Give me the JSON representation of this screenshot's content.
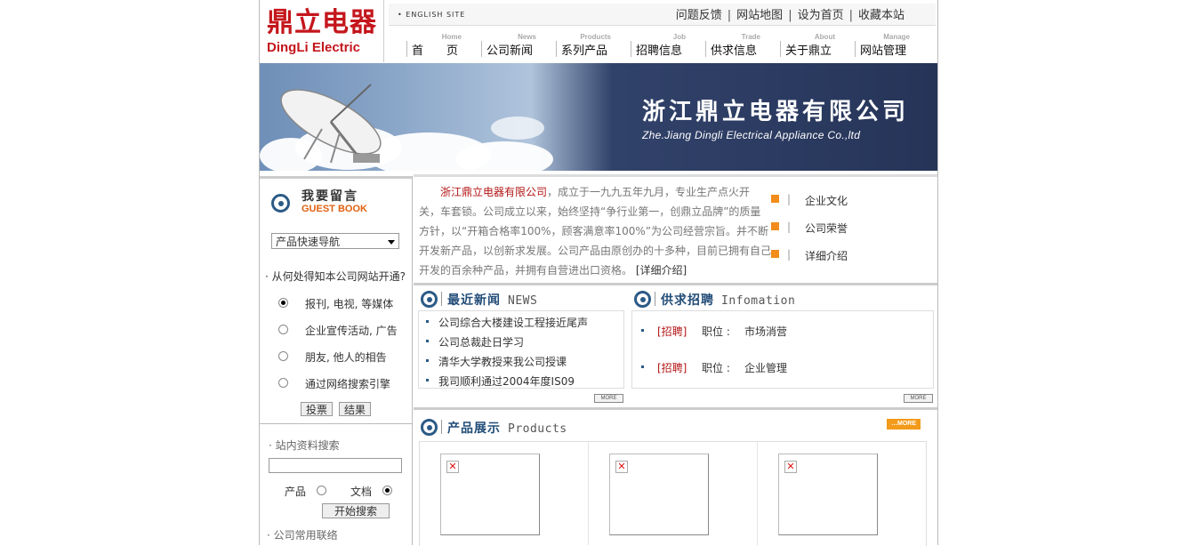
{
  "brand": {
    "cn": "鼎立电器",
    "en": "DingLi Electric"
  },
  "topbar": {
    "english": "ENGLISH SITE",
    "links": [
      "问题反馈",
      "网站地图",
      "设为首页",
      "收藏本站"
    ]
  },
  "nav": [
    {
      "en": "Home",
      "cn": "首　　页"
    },
    {
      "en": "News",
      "cn": "公司新闻"
    },
    {
      "en": "Products",
      "cn": "系列产品"
    },
    {
      "en": "Job",
      "cn": "招聘信息"
    },
    {
      "en": "Trade",
      "cn": "供求信息"
    },
    {
      "en": "About",
      "cn": "关于鼎立"
    },
    {
      "en": "Manage",
      "cn": "网站管理"
    }
  ],
  "banner": {
    "title": "浙江鼎立电器有限公司",
    "subtitle": "Zhe.Jiang Dingli Electrical Appliance Co.,ltd"
  },
  "guestbook": {
    "cn": "我要留言",
    "en": "GUEST BOOK"
  },
  "quicknav": {
    "selected": "产品快速导航"
  },
  "poll": {
    "question": "· 从何处得知本公司网站开通?",
    "options": [
      {
        "label": "报刊, 电视, 等媒体",
        "checked": true
      },
      {
        "label": "企业宣传活动, 广告",
        "checked": false
      },
      {
        "label": "朋友, 他人的相告",
        "checked": false
      },
      {
        "label": "通过网络搜索引擎",
        "checked": false
      }
    ],
    "vote_label": "投票",
    "result_label": "结果"
  },
  "search": {
    "title": "· 站内资料搜索",
    "value": "",
    "options": [
      {
        "label": "产品",
        "checked": false
      },
      {
        "label": "文档",
        "checked": true
      }
    ],
    "button_label": "开始搜索"
  },
  "contact": {
    "title": "· 公司常用联络"
  },
  "intro": {
    "company": "浙江鼎立电器有限公司",
    "body": "，成立于一九九五年九月，专业生产点火开关，车套锁。公司成立以来，始终坚持“争行业第一，创鼎立品牌”的质量方针，以“开箱合格率100%，顾客满意率100%”为公司经营宗旨。并不断开发新产品，以创新求发展。公司产品由原创办的十多种，目前已拥有自己开发的百余种产品，并拥有自营进出口资格。",
    "more": "[详细介绍]",
    "links": [
      "企业文化",
      "公司荣誉",
      "详细介绍"
    ]
  },
  "news": {
    "title": "最近新闻",
    "title_en": "NEWS",
    "items": [
      "公司综合大楼建设工程接近尾声",
      "公司总裁赴日学习",
      "清华大学教授来我公司授课",
      "我司顺利通过2004年度IS09"
    ],
    "more": "MORE"
  },
  "jobs": {
    "title": "供求招聘",
    "title_en": "Infomation",
    "items": [
      {
        "tag": "[招聘]",
        "role": "职位 :",
        "value": "市场消营"
      },
      {
        "tag": "[招聘]",
        "role": "职位 :",
        "value": "企业管理"
      }
    ],
    "more": "MORE"
  },
  "products": {
    "title": "产品展示",
    "title_en": "Products",
    "more": "MORE"
  },
  "colors": {
    "brand_red": "#c4161c",
    "accent_orange": "#f39a1a",
    "section_blue": "#234d78",
    "banner_navy": "#263458"
  }
}
